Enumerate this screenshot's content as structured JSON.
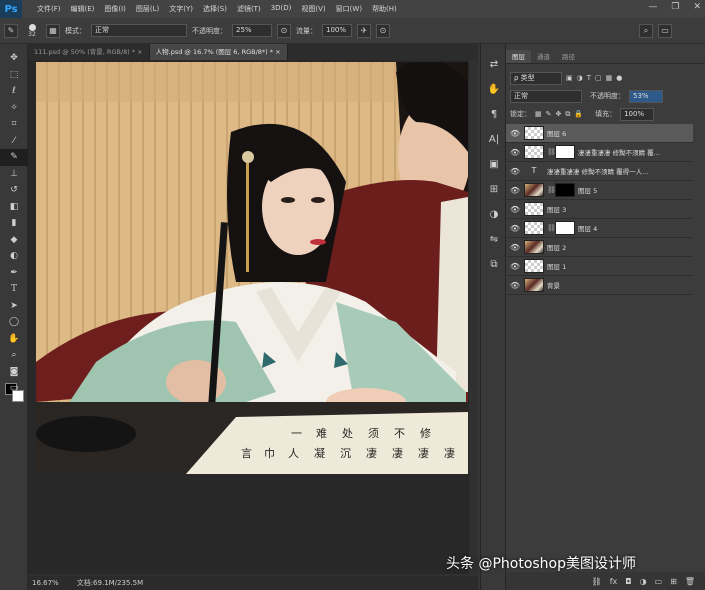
{
  "app": {
    "logo": "Ps"
  },
  "menu": [
    "文件(F)",
    "编辑(E)",
    "图像(I)",
    "图层(L)",
    "文字(Y)",
    "选择(S)",
    "滤镜(T)",
    "3D(D)",
    "视图(V)",
    "窗口(W)",
    "帮助(H)"
  ],
  "window_controls": [
    "—",
    "❐",
    "✕"
  ],
  "options": {
    "brush_size": "32",
    "mode_label": "模式：",
    "mode_value": "正常",
    "opacity_label": "不透明度：",
    "opacity_value": "25%",
    "flow_label": "流量：",
    "flow_value": "100%"
  },
  "tabs": [
    {
      "label": "111.psd @ 50% (背景, RGB/8) *  ×"
    },
    {
      "label": "人物.psd @ 16.7% (图层 6, RGB/8*) *  ×"
    }
  ],
  "status": {
    "zoom": "16.67%",
    "doc": "文档:69.1M/235.5M"
  },
  "panel": {
    "tabs": [
      "图层",
      "通道",
      "路径"
    ],
    "filter_label": "ρ 类型",
    "blend_mode": "正常",
    "opacity_label": "不透明度：",
    "opacity_value": "53%",
    "lock_label": "锁定：",
    "fill_label": "填充：",
    "fill_value": "100%"
  },
  "layers": [
    {
      "name": "图层 6",
      "thumb": "trans",
      "selected": true
    },
    {
      "name": "凄凄重凄凄 修黝不须睛 覆...",
      "thumb": "trans",
      "mask": "white"
    },
    {
      "name": "凄凄重凄凄 修黝不须睛 覆得一人...",
      "thumb": "text"
    },
    {
      "name": "图层 5",
      "thumb": "photo",
      "mask": "black"
    },
    {
      "name": "图层 3",
      "thumb": "trans"
    },
    {
      "name": "图层 4",
      "thumb": "trans",
      "mask": "white"
    },
    {
      "name": "图层 2",
      "thumb": "photo"
    },
    {
      "name": "图层 1",
      "thumb": "trans"
    },
    {
      "name": "背景",
      "thumb": "photo"
    }
  ],
  "watermark": "头条 @Photoshop美图设计师",
  "colors": {
    "fg": "#000000",
    "bg": "#ffffff",
    "accent": "#31a8ff"
  }
}
